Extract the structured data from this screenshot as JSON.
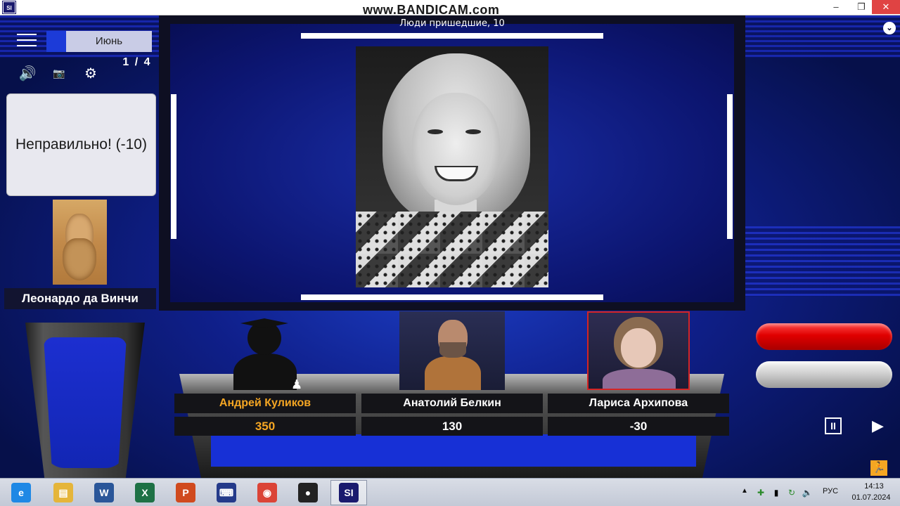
{
  "window": {
    "app_icon": "SI",
    "watermark": "www.BANDICAM.com",
    "minimize": "–",
    "maximize": "❐",
    "close": "✕"
  },
  "header": {
    "round_name": "Июнь",
    "question_counter": "1 / 4"
  },
  "icons": {
    "menu": "menu-icon",
    "speaker": "🔊",
    "camera": "📷",
    "gear": "⚙",
    "pawn": "♟",
    "chevron": "⌄",
    "pause": "II",
    "play": "▶",
    "runner": "🏃"
  },
  "answer_card": {
    "text": "Неправильно! (-10)"
  },
  "answer_person": {
    "name": "Леонардо да Винчи"
  },
  "question": {
    "theme_title": "Люди пришедшие, 10"
  },
  "players": [
    {
      "name": "Андрей Куликов",
      "score": "350",
      "highlight": true
    },
    {
      "name": "Анатолий Белкин",
      "score": "130",
      "highlight": false
    },
    {
      "name": "Лариса Архипова",
      "score": "-30",
      "highlight": false
    }
  ],
  "taskbar": {
    "items": [
      {
        "name": "ie",
        "glyph": "e",
        "color": "#1e88e5"
      },
      {
        "name": "explorer",
        "glyph": "▤",
        "color": "#e5b53a"
      },
      {
        "name": "word",
        "glyph": "W",
        "color": "#2a5699"
      },
      {
        "name": "excel",
        "glyph": "X",
        "color": "#1e7145"
      },
      {
        "name": "powerpoint",
        "glyph": "P",
        "color": "#d04a1e"
      },
      {
        "name": "keyboard",
        "glyph": "⌨",
        "color": "#243a8a"
      },
      {
        "name": "chrome",
        "glyph": "◉",
        "color": "#db4437"
      },
      {
        "name": "record",
        "glyph": "●",
        "color": "#222222"
      },
      {
        "name": "sigame",
        "glyph": "SI",
        "color": "#1a1a6e"
      }
    ],
    "tray_up": "▲",
    "lang": "РУС",
    "time": "14:13",
    "date": "01.07.2024"
  }
}
